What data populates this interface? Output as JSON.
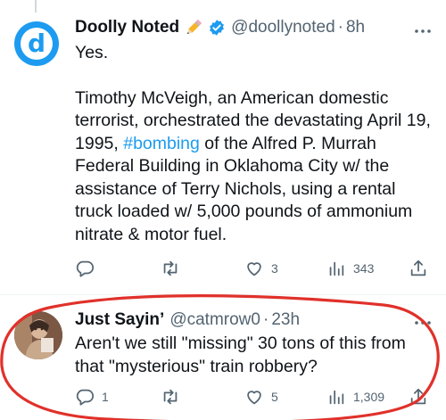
{
  "tweets": [
    {
      "name": "Doolly Noted",
      "handle": "@doollynoted",
      "separator": "·",
      "time": "8h",
      "avatar_text": "d",
      "paragraphs": [
        "Yes.",
        "Timothy McVeigh, an American domestic terrorist, orchestrated the devastating April 19, 1995, ",
        " of the Alfred P. Murrah Federal Building in Oklahoma City w/ the assistance of Terry Nichols, using a rental truck loaded w/ 5,000 pounds of ammonium nitrate & motor fuel."
      ],
      "hashtag": "#bombing",
      "actions": {
        "reply": "",
        "retweet": "",
        "like": "3",
        "views": "343"
      }
    },
    {
      "name": "Just Sayin’",
      "handle": "@catmrow0",
      "separator": "·",
      "time": "23h",
      "text": "Aren't we still \"missing\" 30 tons of this from that \"mysterious\" train robbery?",
      "actions": {
        "reply": "1",
        "retweet": "",
        "like": "5",
        "views": "1,309"
      }
    }
  ],
  "icons": {
    "more": "more-horizontal-icon",
    "verified": "verified-badge-icon",
    "pencil": "pencil-emoji-icon",
    "reply": "reply-icon",
    "retweet": "retweet-icon",
    "like": "heart-icon",
    "views": "views-chart-icon",
    "share": "share-icon"
  },
  "colors": {
    "accent": "#1d9bf0",
    "text": "#0f1419",
    "muted": "#536471",
    "annotation": "#e0312a"
  }
}
